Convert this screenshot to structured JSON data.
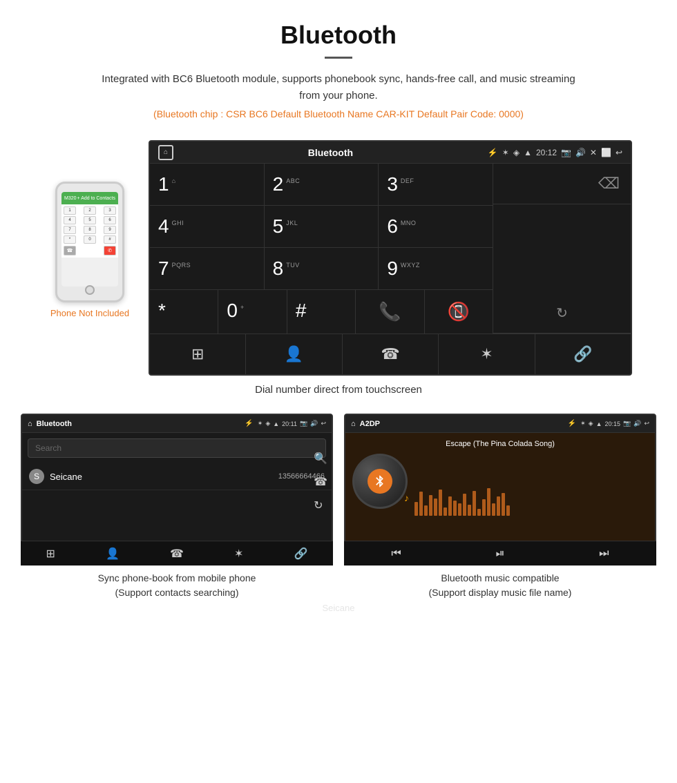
{
  "header": {
    "title": "Bluetooth",
    "description": "Integrated with BC6 Bluetooth module, supports phonebook sync, hands-free call, and music streaming from your phone.",
    "info_line": "(Bluetooth chip : CSR BC6    Default Bluetooth Name CAR-KIT    Default Pair Code: 0000)"
  },
  "main_screen": {
    "status_bar": {
      "title": "Bluetooth",
      "time": "20:12",
      "usb_icon": "⚡",
      "bt_icon": "✶",
      "location_icon": "◈",
      "signal_icon": "▲"
    },
    "dialpad": {
      "keys": [
        {
          "main": "1",
          "sub": "⌂"
        },
        {
          "main": "2",
          "sub": "ABC"
        },
        {
          "main": "3",
          "sub": "DEF"
        },
        {
          "main": "4",
          "sub": "GHI"
        },
        {
          "main": "5",
          "sub": "JKL"
        },
        {
          "main": "6",
          "sub": "MNO"
        },
        {
          "main": "7",
          "sub": "PQRS"
        },
        {
          "main": "8",
          "sub": "TUV"
        },
        {
          "main": "9",
          "sub": "WXYZ"
        },
        {
          "main": "*",
          "sub": ""
        },
        {
          "main": "0",
          "sub": "+"
        },
        {
          "main": "#",
          "sub": ""
        }
      ],
      "action_icons": [
        "⊞",
        "👤",
        "☎",
        "✶",
        "🔗"
      ]
    }
  },
  "dial_caption": "Dial number direct from touchscreen",
  "phone_not_included": "Phone Not Included",
  "phonebook_screen": {
    "title": "Bluetooth",
    "time": "20:11",
    "search_placeholder": "Search",
    "contact": {
      "letter": "S",
      "name": "Seicane",
      "number": "13566664466"
    }
  },
  "music_screen": {
    "title": "A2DP",
    "time": "20:15",
    "song": "Escape (The Pina Colada Song)"
  },
  "bottom_captions": {
    "phonebook": "Sync phone-book from mobile phone\n(Support contacts searching)",
    "music": "Bluetooth music compatible\n(Support display music file name)"
  },
  "watermark": "Seicane"
}
